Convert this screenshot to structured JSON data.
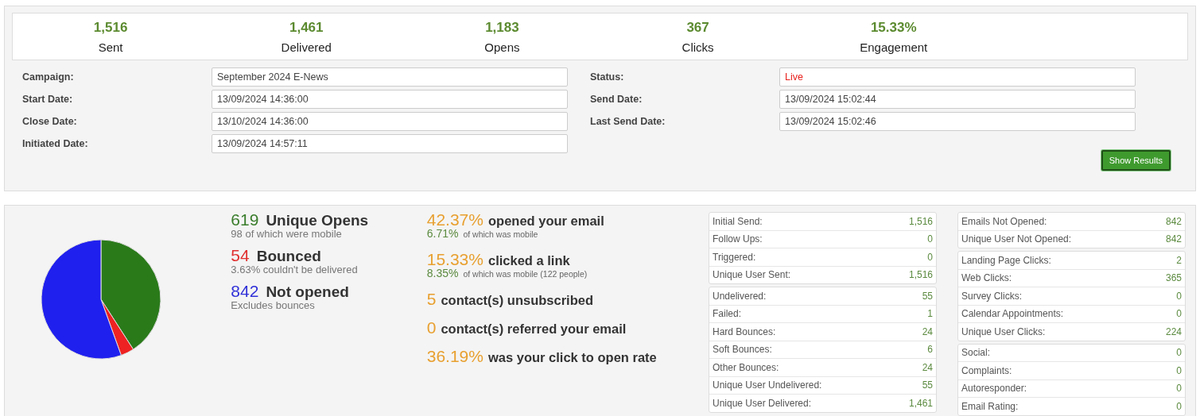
{
  "totals": [
    {
      "value": "1,516",
      "label": "Sent"
    },
    {
      "value": "1,461",
      "label": "Delivered"
    },
    {
      "value": "1,183",
      "label": "Opens"
    },
    {
      "value": "367",
      "label": "Clicks"
    },
    {
      "value": "15.33%",
      "label": "Engagement"
    }
  ],
  "details_left": [
    {
      "label": "Campaign:",
      "value": "September 2024 E-News"
    },
    {
      "label": "Start Date:",
      "value": "13/09/2024 14:36:00"
    },
    {
      "label": "Close Date:",
      "value": "13/10/2024 14:36:00"
    },
    {
      "label": "Initiated Date:",
      "value": "13/09/2024 14:57:11"
    }
  ],
  "details_right": [
    {
      "label": "Status:",
      "value": "Live",
      "kind": "status"
    },
    {
      "label": "Send Date:",
      "value": "13/09/2024 15:02:44",
      "kind": "date"
    },
    {
      "label": "Last Send Date:",
      "value": "13/09/2024 15:02:46",
      "kind": "date"
    }
  ],
  "show_results_button": "Show Results",
  "summary": [
    {
      "value": "619",
      "label": "Unique Opens",
      "note": "98 of which were mobile",
      "color": "#3a7d2c"
    },
    {
      "value": "54",
      "label": "Bounced",
      "note": "3.63% couldn't be delivered",
      "color": "#e03030"
    },
    {
      "value": "842",
      "label": "Not opened",
      "note": "Excludes bounces",
      "color": "#3030d8"
    }
  ],
  "rates": [
    {
      "value": "42.37%",
      "label": "opened your email",
      "sub_value": "6.71%",
      "sub_note": "of which was mobile"
    },
    {
      "value": "15.33%",
      "label": "clicked a link",
      "sub_value": "8.35%",
      "sub_note": "of which was mobile (122 people)"
    },
    {
      "value": "5",
      "label": "contact(s) unsubscribed"
    },
    {
      "value": "0",
      "label": "contact(s) referred your email"
    },
    {
      "value": "36.19%",
      "label": "was your click to open rate"
    }
  ],
  "stat_columns": [
    [
      [
        {
          "label": "Initial Send:",
          "value": "1,516"
        },
        {
          "label": "Follow Ups:",
          "value": "0"
        },
        {
          "label": "Triggered:",
          "value": "0"
        },
        {
          "label": "Unique User Sent:",
          "value": "1,516"
        }
      ],
      [
        {
          "label": "Undelivered:",
          "value": "55"
        },
        {
          "label": "Failed:",
          "value": "1"
        },
        {
          "label": "Hard Bounces:",
          "value": "24"
        },
        {
          "label": "Soft Bounces:",
          "value": "6"
        },
        {
          "label": "Other Bounces:",
          "value": "24"
        },
        {
          "label": "Unique User Undelivered:",
          "value": "55"
        },
        {
          "label": "Unique User Delivered:",
          "value": "1,461"
        }
      ]
    ],
    [
      [
        {
          "label": "Emails Not Opened:",
          "value": "842"
        },
        {
          "label": "Unique User Not Opened:",
          "value": "842"
        }
      ],
      [
        {
          "label": "Landing Page Clicks:",
          "value": "2"
        },
        {
          "label": "Web Clicks:",
          "value": "365"
        },
        {
          "label": "Survey Clicks:",
          "value": "0"
        },
        {
          "label": "Calendar Appointments:",
          "value": "0"
        },
        {
          "label": "Unique User Clicks:",
          "value": "224"
        }
      ],
      [
        {
          "label": "Social:",
          "value": "0"
        },
        {
          "label": "Complaints:",
          "value": "0"
        },
        {
          "label": "Autoresponder:",
          "value": "0"
        },
        {
          "label": "Email Rating:",
          "value": "0"
        }
      ]
    ]
  ]
}
